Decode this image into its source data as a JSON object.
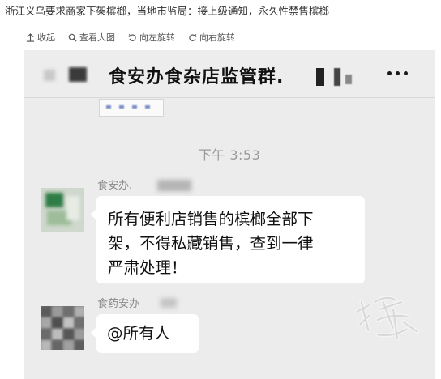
{
  "headline": "浙江义乌要求商家下架槟榔，当地市监局：接上级通知，永久性禁售槟榔",
  "toolbar": {
    "collapse": "收起",
    "view_large": "查看大图",
    "rotate_left": "向左旋转",
    "rotate_right": "向右旋转"
  },
  "chat": {
    "title": "食安办食杂店监管群.",
    "timestamp": "下午 3:53",
    "messages": [
      {
        "sender": "食安办.",
        "text_lines": [
          "所有便利店销售的槟榔全部下",
          "架，不得私藏销售，查到一律",
          "严肃处理！"
        ]
      },
      {
        "sender": "食药安办",
        "text_lines": [
          "@所有人"
        ]
      }
    ]
  },
  "icons": [
    "collapse-icon",
    "search-icon",
    "rotate-left-icon",
    "rotate-right-icon",
    "more-icon",
    "watermark-logo"
  ],
  "colors": {
    "chat_background": "#ececec",
    "header_background": "#ededed",
    "bubble": "#ffffff",
    "timestamp": "#9a9a9a"
  }
}
